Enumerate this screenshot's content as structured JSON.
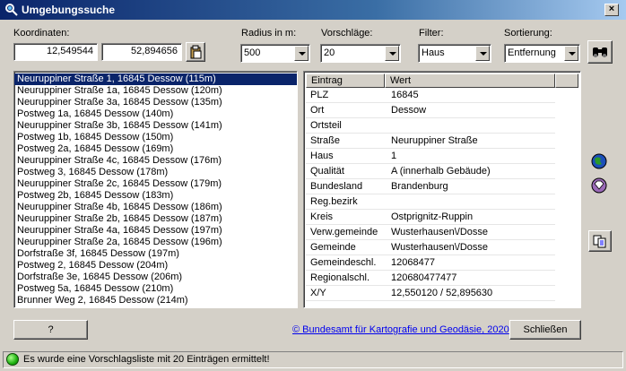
{
  "window": {
    "title": "Umgebungssuche",
    "close_label": "×"
  },
  "coordinates": {
    "label": "Koordinaten:",
    "x": "12,549544",
    "y": "52,894656"
  },
  "radius": {
    "label": "Radius in m:",
    "value": "500"
  },
  "suggestions": {
    "label": "Vorschläge:",
    "value": "20"
  },
  "filter": {
    "label": "Filter:",
    "value": "Haus"
  },
  "sort": {
    "label": "Sortierung:",
    "value": "Entfernung"
  },
  "results": [
    "Neuruppiner Straße 1, 16845 Dessow  (115m)",
    "Neuruppiner Straße 1a, 16845 Dessow  (120m)",
    "Neuruppiner Straße 3a, 16845 Dessow  (135m)",
    "Postweg 1a, 16845 Dessow  (140m)",
    "Neuruppiner Straße 3b, 16845 Dessow  (141m)",
    "Postweg 1b, 16845 Dessow  (150m)",
    "Postweg 2a, 16845 Dessow  (169m)",
    "Neuruppiner Straße 4c, 16845 Dessow  (176m)",
    "Postweg 3, 16845 Dessow  (178m)",
    "Neuruppiner Straße 2c, 16845 Dessow  (179m)",
    "Postweg 2b, 16845 Dessow  (183m)",
    "Neuruppiner Straße 4b, 16845 Dessow  (186m)",
    "Neuruppiner Straße 2b, 16845 Dessow  (187m)",
    "Neuruppiner Straße 4a, 16845 Dessow  (197m)",
    "Neuruppiner Straße 2a, 16845 Dessow  (196m)",
    "Dorfstraße 3f, 16845 Dessow  (197m)",
    "Postweg 2, 16845 Dessow  (204m)",
    "Dorfstraße 3e, 16845 Dessow  (206m)",
    "Postweg 5a, 16845 Dessow  (210m)",
    "Brunner Weg 2, 16845 Dessow  (214m)"
  ],
  "details": {
    "col_entry": "Eintrag",
    "col_value": "Wert",
    "rows": [
      {
        "entry": "PLZ",
        "value": "16845"
      },
      {
        "entry": "Ort",
        "value": "Dessow"
      },
      {
        "entry": "Ortsteil",
        "value": ""
      },
      {
        "entry": "Straße",
        "value": "Neuruppiner Straße"
      },
      {
        "entry": "Haus",
        "value": "1"
      },
      {
        "entry": "Qualität",
        "value": "A (innerhalb Gebäude)"
      },
      {
        "entry": "Bundesland",
        "value": "Brandenburg"
      },
      {
        "entry": "Reg.bezirk",
        "value": ""
      },
      {
        "entry": "Kreis",
        "value": "Ostprignitz-Ruppin"
      },
      {
        "entry": "Verw.gemeinde",
        "value": "Wusterhausen\\/Dosse"
      },
      {
        "entry": "Gemeinde",
        "value": "Wusterhausen\\/Dosse"
      },
      {
        "entry": "Gemeindeschl.",
        "value": "12068477"
      },
      {
        "entry": "Regionalschl.",
        "value": "120680477477"
      },
      {
        "entry": "X/Y",
        "value": "12,550120 / 52,895630"
      }
    ]
  },
  "buttons": {
    "help": "?",
    "close": "Schließen"
  },
  "copyright_link": "© Bundesamt für Kartografie und Geodäsie, 2020",
  "status": {
    "text": "Es wurde eine Vorschlagsliste mit 20 Einträgen ermittelt!"
  },
  "colors": {
    "selection": "#0a246a",
    "status_ok": "#1db10f"
  }
}
